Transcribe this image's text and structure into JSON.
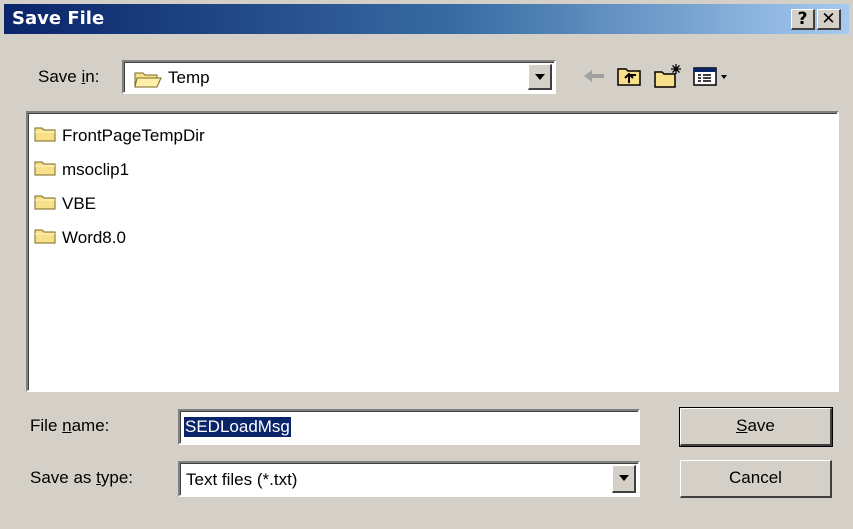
{
  "window": {
    "title": "Save File",
    "help_label": "?",
    "close_label": "✕"
  },
  "save_in": {
    "label_pre": "Save ",
    "label_key": "i",
    "label_post": "n:",
    "value": "Temp"
  },
  "toolbar": {
    "icons": [
      "back-arrow-icon",
      "up-folder-icon",
      "new-folder-icon",
      "view-menu-icon"
    ]
  },
  "files": [
    {
      "name": "FrontPageTempDir",
      "icon": "folder-icon"
    },
    {
      "name": "msoclip1",
      "icon": "folder-icon"
    },
    {
      "name": "VBE",
      "icon": "folder-icon"
    },
    {
      "name": "Word8.0",
      "icon": "folder-icon"
    }
  ],
  "file_name": {
    "label_pre": "File ",
    "label_key": "n",
    "label_post": "ame:",
    "value": "SEDLoadMsg"
  },
  "save_as_type": {
    "label_pre": "Save as ",
    "label_key": "t",
    "label_post": "ype:",
    "value": "Text files (*.txt)"
  },
  "buttons": {
    "save": {
      "key": "S",
      "rest": "ave"
    },
    "cancel": "Cancel"
  },
  "colors": {
    "title_bar": "#0a246a",
    "dialog_bg": "#d4d0c8",
    "selection": "#0a246a"
  }
}
